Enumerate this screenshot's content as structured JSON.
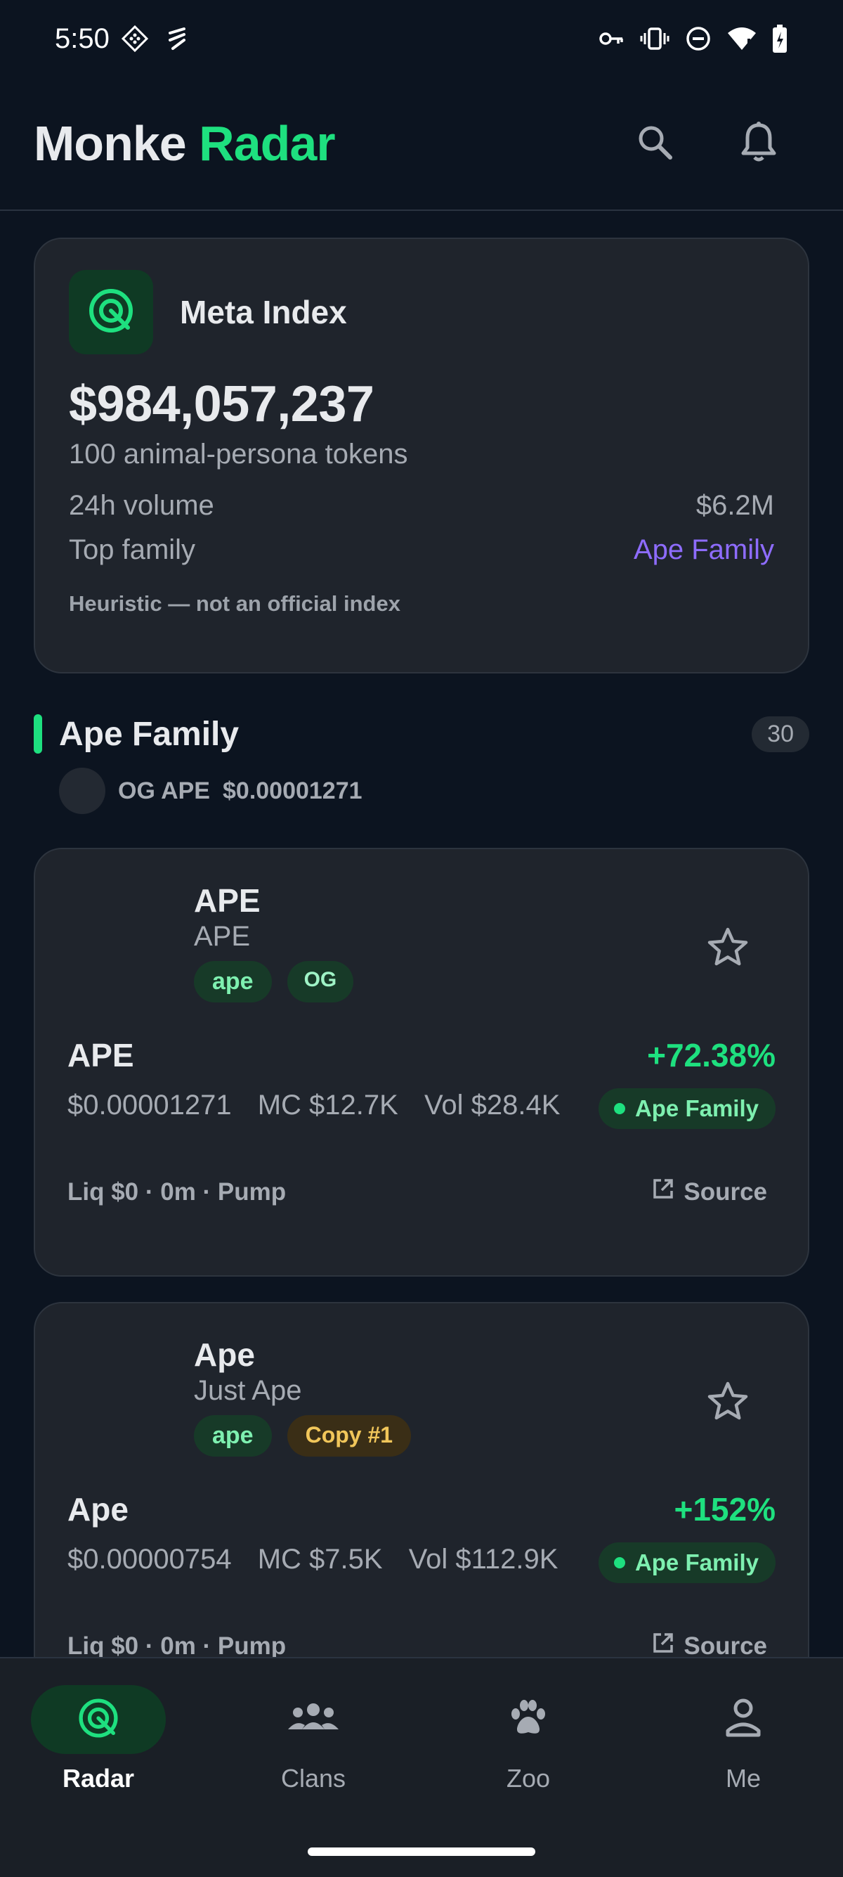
{
  "status_bar": {
    "time": "5:50"
  },
  "app_bar": {
    "title_part1": "Monke",
    "title_part2": "Radar"
  },
  "meta_index": {
    "title": "Meta Index",
    "value": "$984,057,237",
    "subtitle": "100 animal-persona tokens",
    "volume_label": "24h volume",
    "volume_value": "$6.2M",
    "top_family_label": "Top family",
    "top_family_value": "Ape Family",
    "note": "Heuristic — not an official index"
  },
  "section": {
    "title": "Ape Family",
    "count": "30",
    "og_label": "OG APE",
    "og_price": "$0.00001271"
  },
  "tokens": [
    {
      "name": "APE",
      "subname": "APE",
      "tag1": "ape",
      "tag2": "OG",
      "symbol": "APE",
      "change": "+72.38%",
      "price": "$0.00001271",
      "mc": "MC $12.7K",
      "vol": "Vol $28.4K",
      "family": "Ape Family",
      "meta": "Liq $0 · 0m · Pump",
      "source": "Source"
    },
    {
      "name": "Ape",
      "subname": "Just Ape",
      "tag1": "ape",
      "tag2": "Copy #1",
      "symbol": "Ape",
      "change": "+152%",
      "price": "$0.00000754",
      "mc": "MC $7.5K",
      "vol": "Vol $112.9K",
      "family": "Ape Family",
      "meta": "Liq $0 · 0m · Pump",
      "source": "Source"
    }
  ],
  "nav": {
    "radar": "Radar",
    "clans": "Clans",
    "zoo": "Zoo",
    "me": "Me"
  },
  "colors": {
    "accent": "#1ee07f",
    "purple": "#8e6cff",
    "background": "#0c1420",
    "card": "#1f242c"
  }
}
